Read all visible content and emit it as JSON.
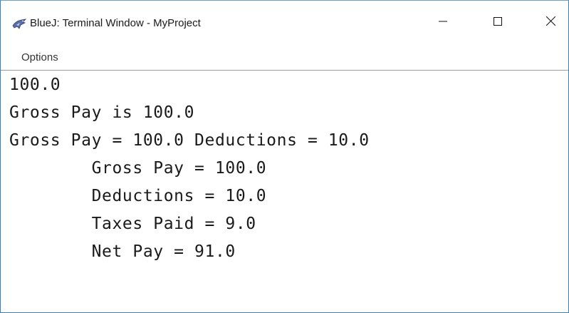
{
  "window": {
    "title": "BlueJ: Terminal Window - MyProject",
    "icon": "bluej-bird-icon",
    "controls": {
      "minimize_glyph": "—",
      "maximize_glyph": "☐",
      "close_glyph": "✕"
    }
  },
  "menubar": {
    "items": [
      {
        "label": "Options"
      }
    ]
  },
  "terminal": {
    "lines": [
      "100.0",
      "Gross Pay is 100.0",
      "Gross Pay = 100.0 Deductions = 10.0",
      "        Gross Pay = 100.0",
      "        Deductions = 10.0",
      "        Taxes Paid = 9.0",
      "        Net Pay = 91.0"
    ]
  },
  "colors": {
    "window_border": "#3c7fb1",
    "background": "#ffffff",
    "text": "#1a1a1a"
  }
}
